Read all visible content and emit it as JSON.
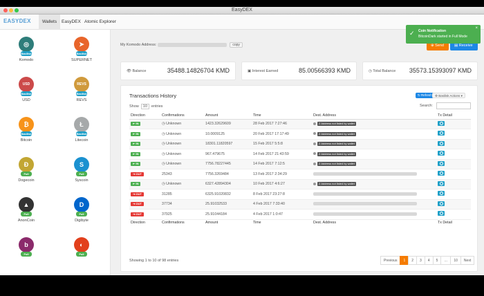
{
  "window": {
    "title": "EasyDEX"
  },
  "nav": {
    "brand_prefix": "",
    "brand": "EASYDEX",
    "tabs": [
      "Wallets",
      "EasyDEX",
      "Atomic Explorer"
    ]
  },
  "coins": [
    {
      "name": "Komodo",
      "badge": "Basilisk",
      "color": "#2e7d7a",
      "glyph": "◎"
    },
    {
      "name": "SUPERNET",
      "badge": "Basilisk",
      "color": "#e8652b",
      "glyph": "➤"
    },
    {
      "name": "USD",
      "badge": "Basilisk",
      "color": "#cc4a4a",
      "glyph": "USD"
    },
    {
      "name": "REVS",
      "badge": "Basilisk",
      "color": "#d09a3c",
      "glyph": "REVS"
    },
    {
      "name": "Bitcoin",
      "badge": "Basilisk",
      "color": "#f7931a",
      "glyph": "₿"
    },
    {
      "name": "Litecoin",
      "badge": "Basilisk",
      "color": "#a6a9aa",
      "glyph": "Ł"
    },
    {
      "name": "Dogecoin",
      "badge": "Full",
      "color": "#c2a633",
      "glyph": "Ð"
    },
    {
      "name": "Syscoin",
      "badge": "Full",
      "color": "#1b91d0",
      "glyph": "S"
    },
    {
      "name": "AnonCoin",
      "badge": "Full",
      "color": "#333333",
      "glyph": "▲"
    },
    {
      "name": "Digibyte",
      "badge": "Full",
      "color": "#0066cc",
      "glyph": "D"
    },
    {
      "name": "",
      "badge": "Full",
      "color": "#8b2a6b",
      "glyph": "b"
    },
    {
      "name": "",
      "badge": "Full",
      "color": "#e2401c",
      "glyph": "◐"
    }
  ],
  "header": {
    "address_label": "My Komodo Address:",
    "copy_label": "copy",
    "send_label": "Send",
    "receive_label": "Receive"
  },
  "balances": [
    {
      "label": "Balance",
      "value": "35488.14826704 KMD"
    },
    {
      "label": "Interest Earned",
      "value": "85.00566393 KMD"
    },
    {
      "label": "Total Balance",
      "value": "35573.15393097 KMD"
    }
  ],
  "history": {
    "title": "Transactions History",
    "refresh_label": "Refresh",
    "actions_label": "Basilisk Actions",
    "show_label": "Show",
    "show_value": "10",
    "entries_label": "entries",
    "search_label": "Search:",
    "columns": [
      "Direction",
      "Confirmations",
      "Amount",
      "Time",
      "Dest. Address",
      "Tx Detail"
    ],
    "rows": [
      {
        "dir": "IN",
        "conf": "Unknown",
        "amount": "1423.32629609",
        "time": "28 Feb 2017 7:27:46",
        "addr": "Z Address not listed by wallet"
      },
      {
        "dir": "IN",
        "conf": "Unknown",
        "amount": "10.0009125",
        "time": "20 Feb 2017 17:17:49",
        "addr": "Z Address not listed by wallet"
      },
      {
        "dir": "IN",
        "conf": "Unknown",
        "amount": "18301.11820597",
        "time": "15 Feb 2017 5:5:8",
        "addr": "Z Address not listed by wallet"
      },
      {
        "dir": "IN",
        "conf": "Unknown",
        "amount": "967.479675",
        "time": "14 Feb 2017 21:43:59",
        "addr": "Z Address not listed by wallet"
      },
      {
        "dir": "IN",
        "conf": "Unknown",
        "amount": "7756.78227445",
        "time": "14 Feb 2017 7:12:5",
        "addr": "Z Address not listed by wallet"
      },
      {
        "dir": "OUT",
        "conf": "25343",
        "amount": "7756.3269484",
        "time": "13 Feb 2017 2:34:29",
        "addr": ""
      },
      {
        "dir": "IN",
        "conf": "Unknown",
        "amount": "6327.42894304",
        "time": "10 Feb 2017 4:6:27",
        "addr": "Z Address not listed by wallet"
      },
      {
        "dir": "OUT",
        "conf": "31285",
        "amount": "6325.91020832",
        "time": "8 Feb 2017 23:27:8",
        "addr": ""
      },
      {
        "dir": "OUT",
        "conf": "37734",
        "amount": "25.91032533",
        "time": "4 Feb 2017 7:33:40",
        "addr": ""
      },
      {
        "dir": "OUT",
        "conf": "37925",
        "amount": "25.91044184",
        "time": "4 Feb 2017 1:0:47",
        "addr": ""
      }
    ],
    "showing": "Showing 1 to 10 of 98 entries",
    "pager": [
      "Previous",
      "1",
      "2",
      "3",
      "4",
      "5",
      "…",
      "10",
      "Next"
    ]
  },
  "toast": {
    "title": "Coin Notification",
    "message": "BitcoinDark started in Full Mode"
  }
}
